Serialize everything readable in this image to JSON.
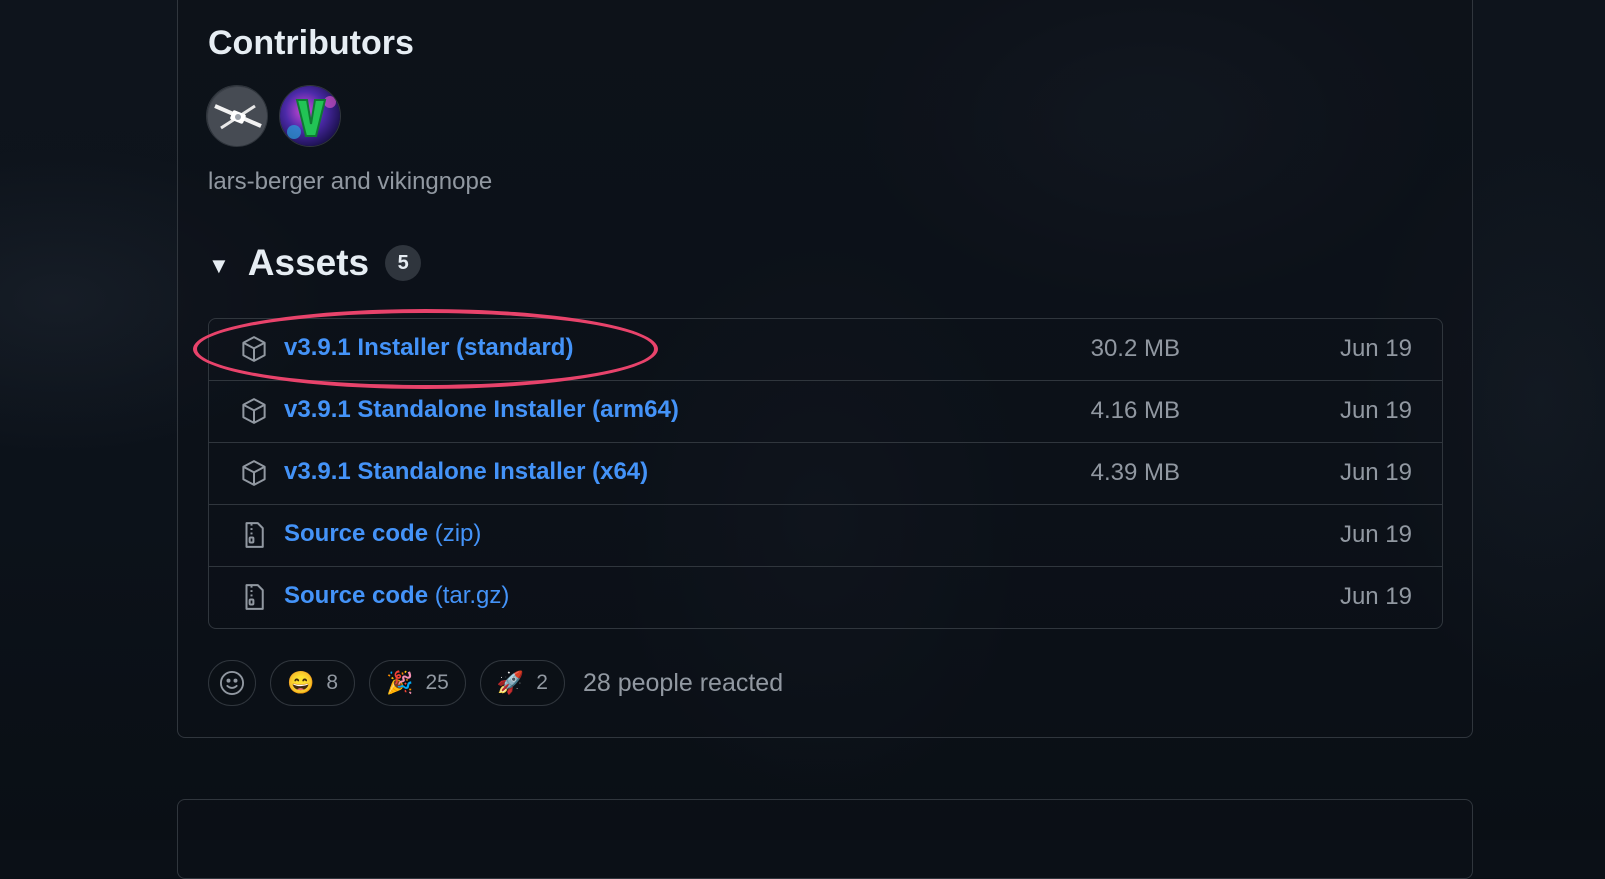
{
  "contributors": {
    "title": "Contributors",
    "names": "lars-berger and vikingnope",
    "avatars": [
      {
        "name": "lars-berger"
      },
      {
        "name": "vikingnope"
      }
    ]
  },
  "assets": {
    "title": "Assets",
    "count": "5",
    "items": [
      {
        "icon": "package-icon",
        "label": "v3.9.1 Installer (standard)",
        "suffix": "",
        "size": "30.2 MB",
        "date": "Jun 19"
      },
      {
        "icon": "package-icon",
        "label": "v3.9.1 Standalone Installer (arm64)",
        "suffix": "",
        "size": "4.16 MB",
        "date": "Jun 19"
      },
      {
        "icon": "package-icon",
        "label": "v3.9.1 Standalone Installer (x64)",
        "suffix": "",
        "size": "4.39 MB",
        "date": "Jun 19"
      },
      {
        "icon": "file-zip-icon",
        "label": "Source code",
        "suffix": " (zip)",
        "size": "",
        "date": "Jun 19"
      },
      {
        "icon": "file-zip-icon",
        "label": "Source code",
        "suffix": " (tar.gz)",
        "size": "",
        "date": "Jun 19"
      }
    ]
  },
  "reactions": {
    "items": [
      {
        "emoji": "😄",
        "count": "8"
      },
      {
        "emoji": "🎉",
        "count": "25"
      },
      {
        "emoji": "🚀",
        "count": "2"
      }
    ],
    "summary": "28 people reacted"
  },
  "colors": {
    "link": "#4493f8",
    "muted": "#9198a1",
    "border": "#30363d",
    "highlight": "#e8436b"
  }
}
